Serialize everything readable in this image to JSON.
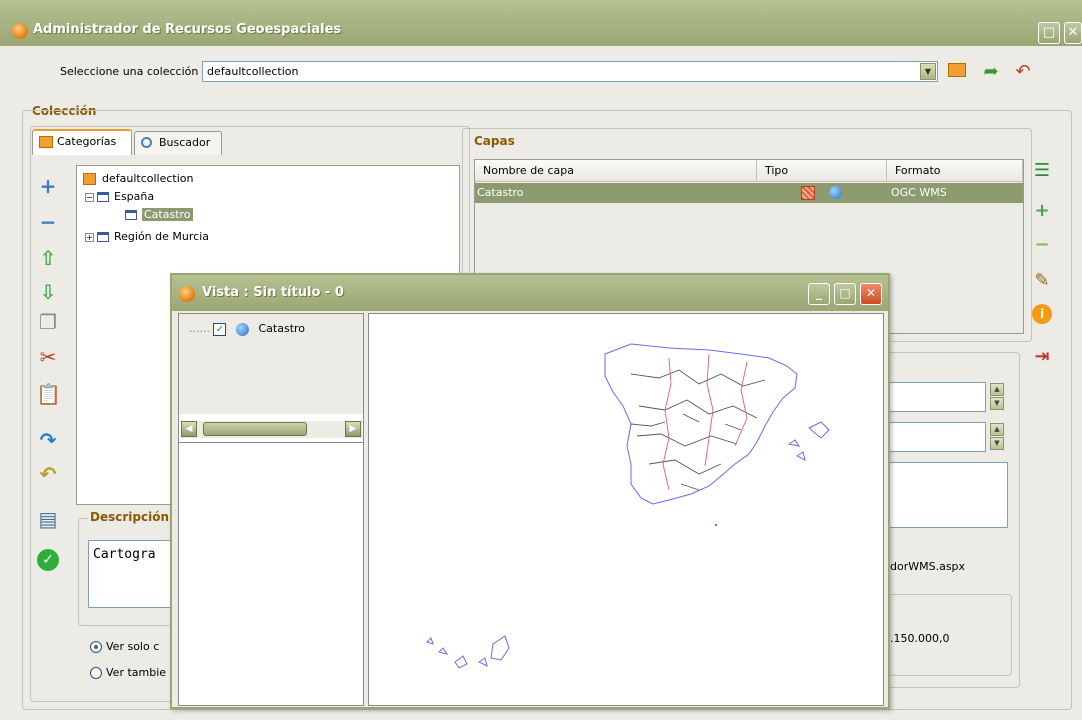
{
  "window": {
    "title": "Administrador de Recursos Geoespaciales"
  },
  "collection_selector": {
    "label": "Seleccione una colección",
    "value": "defaultcollection"
  },
  "coleccion": {
    "title": "Colección",
    "tabs": [
      {
        "label": "Categorías"
      },
      {
        "label": "Buscador"
      }
    ],
    "tree": [
      {
        "label": "defaultcollection"
      },
      {
        "label": "España"
      },
      {
        "label": "Catastro"
      },
      {
        "label": "Región de Murcia"
      }
    ],
    "description": {
      "title": "Descripción",
      "text": "Cartogra"
    },
    "radios": [
      {
        "label": "Ver solo c"
      },
      {
        "label": "Ver tambie"
      }
    ]
  },
  "capas": {
    "title": "Capas",
    "columns": [
      "Nombre de capa",
      "Tipo",
      "Formato"
    ],
    "rows": [
      {
        "name": "Catastro",
        "format": "OGC WMS"
      }
    ],
    "url_partial": "dorWMS.aspx",
    "scale_partial": ".150.000,0"
  },
  "vista": {
    "title": "Vista : Sin título - 0",
    "layers": [
      {
        "label": "Catastro",
        "checked": true
      }
    ]
  },
  "icons": {
    "accent": "#9aa673",
    "selection": "#8d9a6e",
    "title_accent": "#8a5a00"
  }
}
